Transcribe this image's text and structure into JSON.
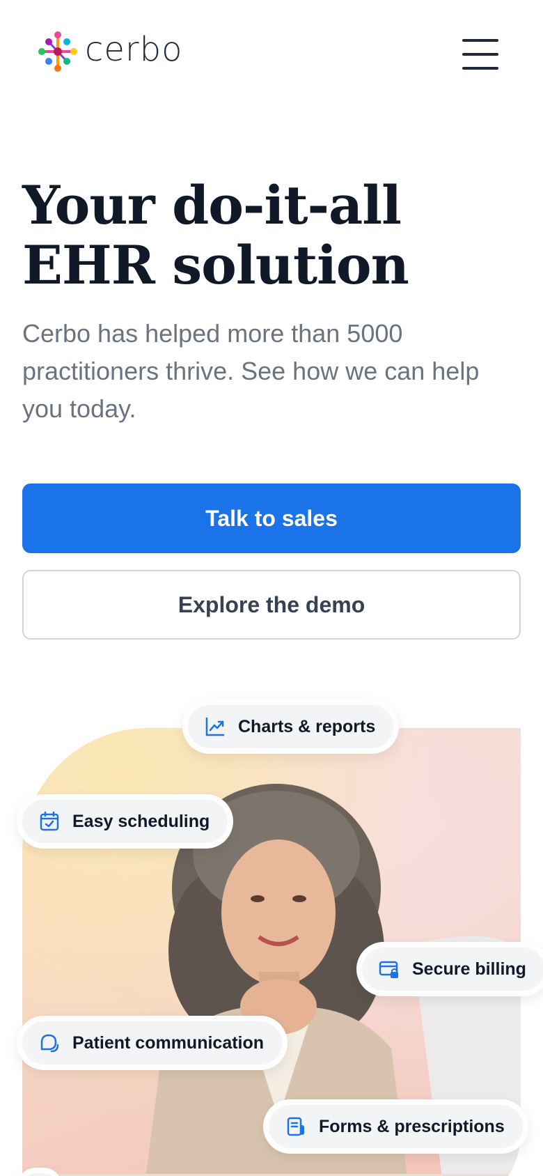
{
  "header": {
    "brand": "cerbo",
    "menu_icon": "hamburger-menu-icon"
  },
  "hero": {
    "title_line1": "Your do-it-all",
    "title_line2": "EHR solution",
    "subtitle": "Cerbo has helped more than 5000 practitioners thrive. See how we can help you today.",
    "primary_cta": "Talk to sales",
    "secondary_cta": "Explore the demo"
  },
  "features": [
    {
      "label": "Charts & reports",
      "icon": "chart-trend-icon"
    },
    {
      "label": "Easy scheduling",
      "icon": "calendar-check-icon"
    },
    {
      "label": "Secure billing",
      "icon": "credit-card-lock-icon"
    },
    {
      "label": "Patient communication",
      "icon": "chat-bubbles-icon"
    },
    {
      "label": "Forms & prescriptions",
      "icon": "document-icon"
    }
  ],
  "colors": {
    "primary": "#1a73e8",
    "heading": "#111827",
    "body_text": "#6b7280",
    "icon_blue": "#1a73e8"
  }
}
